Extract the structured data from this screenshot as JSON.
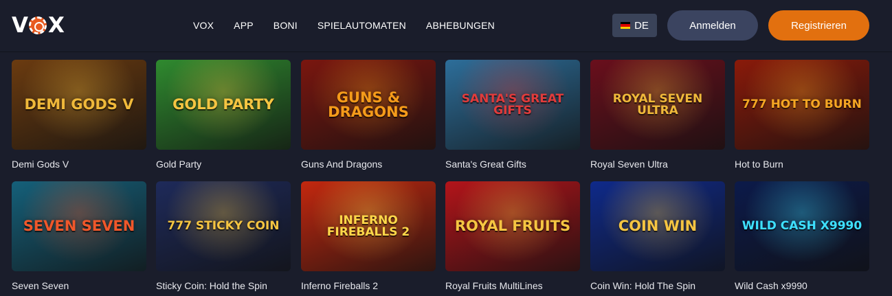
{
  "header": {
    "logo": "VOX",
    "nav": [
      "VOX",
      "APP",
      "BONI",
      "SPIELAUTOMATEN",
      "ABHEBUNGEN"
    ],
    "language": "DE",
    "login_label": "Anmelden",
    "register_label": "Registrieren",
    "colors": {
      "background": "#1a1d2b",
      "login": "#3b4460",
      "register": "#e2700f",
      "lang": "#3a4359"
    }
  },
  "games": [
    {
      "name": "Demi Gods V",
      "art_text": "DEMI GODS V",
      "bg": "#6b3b10",
      "accent": "#f0b93a"
    },
    {
      "name": "Gold Party",
      "art_text": "GOLD PARTY",
      "bg": "#2f8a2f",
      "accent": "#f5c542"
    },
    {
      "name": "Guns And Dragons",
      "art_text": "GUNS & DRAGONS",
      "bg": "#7a160f",
      "accent": "#f59b1a"
    },
    {
      "name": "Santa's Great Gifts",
      "art_text": "SANTA'S GREAT GIFTS",
      "bg": "#2d6e9a",
      "accent": "#e23b3b"
    },
    {
      "name": "Royal Seven Ultra",
      "art_text": "ROYAL SEVEN ultra",
      "bg": "#6a0f1c",
      "accent": "#f0b93a"
    },
    {
      "name": "Hot to Burn",
      "art_text": "777 HOT TO BURN",
      "bg": "#8a1a0a",
      "accent": "#f5a623"
    },
    {
      "name": "Seven Seven",
      "art_text": "SEVEN SEVEN",
      "bg": "#15607a",
      "accent": "#f0572a"
    },
    {
      "name": "Sticky Coin: Hold the Spin",
      "art_text": "777 STICKY COIN",
      "bg": "#1e2a5a",
      "accent": "#f5c542"
    },
    {
      "name": "Inferno Fireballs 2",
      "art_text": "INFERNO FIREBALLS 2",
      "bg": "#c3280f",
      "accent": "#ffd84a"
    },
    {
      "name": "Royal Fruits MultiLines",
      "art_text": "ROYAL FRUITS",
      "bg": "#b3141a",
      "accent": "#f5c542"
    },
    {
      "name": "Coin Win: Hold The Spin",
      "art_text": "COIN WIN",
      "bg": "#0f2a8a",
      "accent": "#f5c542"
    },
    {
      "name": "Wild Cash x9990",
      "art_text": "Wild CASH x9990",
      "bg": "#0c1a4a",
      "accent": "#3ee0ff"
    }
  ]
}
